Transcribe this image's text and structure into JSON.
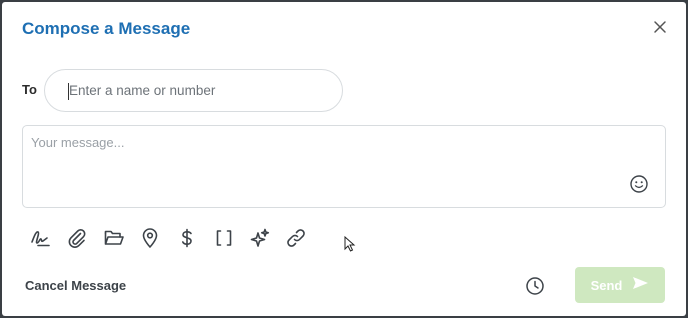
{
  "dialog": {
    "title": "Compose a Message"
  },
  "recipient": {
    "label": "To",
    "placeholder": "Enter a name or number",
    "value": ""
  },
  "message": {
    "placeholder": "Your message...",
    "value": ""
  },
  "toolbar": {
    "icons": [
      "signature-icon",
      "paperclip-icon",
      "folder-icon",
      "location-pin-icon",
      "dollar-icon",
      "brackets-icon",
      "sparkles-icon",
      "link-icon"
    ]
  },
  "footer": {
    "cancel_label": "Cancel Message",
    "send_label": "Send"
  },
  "colors": {
    "title": "#1e6fb3",
    "send_button_disabled": "#cfe8c0",
    "border": "#d8dcdf"
  }
}
